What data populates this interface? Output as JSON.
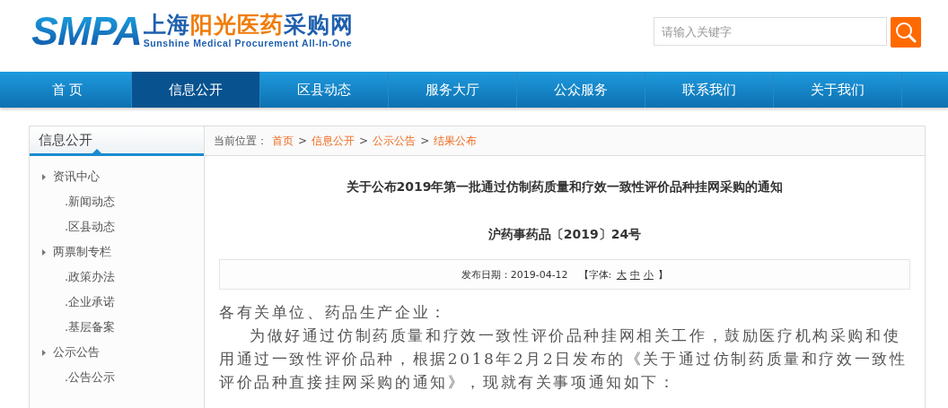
{
  "logo": {
    "mark": "SMPA",
    "title_parts": [
      {
        "text": "上海",
        "highlight": false
      },
      {
        "text": "阳光医药",
        "highlight": true
      },
      {
        "text": "采购网",
        "highlight": false
      }
    ],
    "subtitle": "Sunshine Medical Procurement All-In-One"
  },
  "search": {
    "placeholder": "请输入关键字"
  },
  "nav": [
    {
      "label": "首 页",
      "selected": false
    },
    {
      "label": "信息公开",
      "selected": true
    },
    {
      "label": "区县动态",
      "selected": false
    },
    {
      "label": "服务大厅",
      "selected": false
    },
    {
      "label": "公众服务",
      "selected": false
    },
    {
      "label": "联系我们",
      "selected": false
    },
    {
      "label": "关于我们",
      "selected": false
    }
  ],
  "sidebar": {
    "title": "信息公开",
    "items": [
      {
        "label": "资讯中心",
        "children": [
          {
            "label": ".新闻动态"
          },
          {
            "label": ".区县动态"
          }
        ]
      },
      {
        "label": "两票制专栏",
        "children": [
          {
            "label": ".政策办法"
          },
          {
            "label": ".企业承诺"
          },
          {
            "label": ".基层备案"
          }
        ]
      },
      {
        "label": "公示公告",
        "children": [
          {
            "label": ".公告公示"
          }
        ]
      }
    ]
  },
  "breadcrumb": {
    "label": "当前位置：",
    "links": [
      "首页",
      "信息公开",
      "公示公告",
      "结果公布"
    ],
    "separator": ">"
  },
  "article": {
    "title": "关于公布2019年第一批通过仿制药质量和疗效一致性评价品种挂网采购的通知",
    "doc_number": "沪药事药品〔2019〕24号",
    "date": "发布日期：2019-04-12",
    "font_label": "【字体:",
    "font_sizes": [
      "大",
      "中",
      "小"
    ],
    "font_close": "】",
    "paragraphs": [
      {
        "kind": "salutation",
        "text": "各有关单位、药品生产企业："
      },
      {
        "kind": "indented",
        "text": "为做好通过仿制药质量和疗效一致性评价品种挂网相关工作，鼓励医疗机构采购和使用通过一致性评价品种，根据2018年2月2日发布的《关于通过仿制药质量和疗效一致性评价品种直接挂网采购的通知》，现就有关事项通知如下："
      }
    ]
  }
}
